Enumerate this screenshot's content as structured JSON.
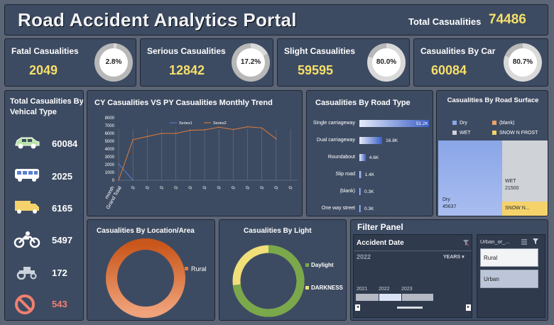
{
  "header": {
    "title": "Road Accident Analytics Portal",
    "total_label": "Total Casualities",
    "total_value": "74486"
  },
  "kpis": [
    {
      "label": "Fatal Casualities",
      "value": "2049",
      "pct": "2.8%",
      "fraction": 0.028
    },
    {
      "label": "Serious Casualities",
      "value": "12842",
      "pct": "17.2%",
      "fraction": 0.172
    },
    {
      "label": "Slight Casualities",
      "value": "59595",
      "pct": "80.0%",
      "fraction": 0.8
    },
    {
      "label": "Casualities By Car",
      "value": "60084",
      "pct": "80.7%",
      "fraction": 0.807
    }
  ],
  "vehicles": {
    "title": "Total Casualities By Vehical Type",
    "items": [
      {
        "icon": "car-icon",
        "value": "60084",
        "color": "#ffffff"
      },
      {
        "icon": "bus-icon",
        "value": "2025",
        "color": "#ffffff"
      },
      {
        "icon": "truck-icon",
        "value": "6165",
        "color": "#ffffff"
      },
      {
        "icon": "motorcycle-icon",
        "value": "5497",
        "color": "#ffffff"
      },
      {
        "icon": "tractor-icon",
        "value": "172",
        "color": "#ffffff"
      },
      {
        "icon": "prohibited-icon",
        "value": "543",
        "color": "#f08070"
      }
    ]
  },
  "trend": {
    "title": "CY Casualities VS PY Casualities Monthly Trend",
    "legend": [
      "Series1",
      "Series2"
    ]
  },
  "road_type": {
    "title": "Casualities  By  Road  Type"
  },
  "surface": {
    "title": "Casualities By Road Surface",
    "legend": [
      "Dry",
      "(blank)",
      "WET",
      "SNOW N FROST"
    ],
    "dry_label": "Dry",
    "dry_value": "45637",
    "wet_label": "WET",
    "wet_value": "21500",
    "snow_label": "SNOW N..."
  },
  "location": {
    "title": "Casualities By Location/Area",
    "legend": "Rural"
  },
  "light": {
    "title": "Casualities By Light",
    "legend": [
      "Daylight",
      "DARKNESS"
    ]
  },
  "filter": {
    "title": "Filter Panel",
    "date_label": "Accident Date",
    "selected_year": "2022",
    "period": "YEARS",
    "years": [
      "2021",
      "2022",
      "2023"
    ],
    "slicer_label": "Urban_or_...",
    "options": [
      "Rural",
      "Urban"
    ]
  },
  "colors": {
    "gold": "#f7df6a",
    "panel": "#3d4b62",
    "series1": "#5b7fcf",
    "series2": "#e07b39"
  },
  "chart_data": [
    {
      "type": "line",
      "title": "CY Casualities VS PY Casualities Monthly Trend",
      "x": [
        "month Grand Total",
        "0",
        "0",
        "0",
        "0",
        "0",
        "0",
        "0",
        "0",
        "0",
        "0",
        "0",
        "0"
      ],
      "ylim": [
        0,
        8000
      ],
      "yticks": [
        0,
        1000,
        2000,
        3000,
        4000,
        5000,
        6000,
        7000,
        8000
      ],
      "xtick_labels": [
        "month",
        "Grand Total",
        "0",
        "0",
        "0",
        "0",
        "0",
        "0",
        "0",
        "0",
        "0",
        "0",
        "0",
        "0"
      ],
      "series": [
        {
          "name": "Series1",
          "values": [
            2100,
            0,
            null,
            null,
            null,
            null,
            null,
            null,
            null,
            null,
            null,
            null,
            null
          ]
        },
        {
          "name": "Series2",
          "values": [
            0,
            5200,
            5600,
            6000,
            6000,
            6400,
            6450,
            6800,
            6500,
            6850,
            6700,
            5300,
            null
          ]
        }
      ]
    },
    {
      "type": "bar",
      "title": "Casualities  By  Road  Type",
      "categories": [
        "Single carriageway",
        "Dual carriageway",
        "Roundabout",
        "Slip road",
        "(blank)",
        "One way street"
      ],
      "values": [
        51200,
        16800,
        4600,
        1400,
        300,
        300
      ],
      "labels": [
        "51.2K",
        "16.8K",
        "4.6K",
        "1.4K",
        "0.3K",
        "0.3K"
      ]
    },
    {
      "type": "area",
      "title": "Casualities By Road Surface",
      "categories": [
        "Dry",
        "WET",
        "SNOW N FROST"
      ],
      "values": [
        45637,
        21500,
        5000
      ]
    },
    {
      "type": "pie",
      "title": "Casualities By Location/Area",
      "categories": [
        "Rural",
        "Urban"
      ],
      "values": [
        0.62,
        0.38
      ]
    },
    {
      "type": "pie",
      "title": "Casualities By Light",
      "categories": [
        "Daylight",
        "DARKNESS"
      ],
      "values": [
        0.73,
        0.27
      ]
    }
  ]
}
